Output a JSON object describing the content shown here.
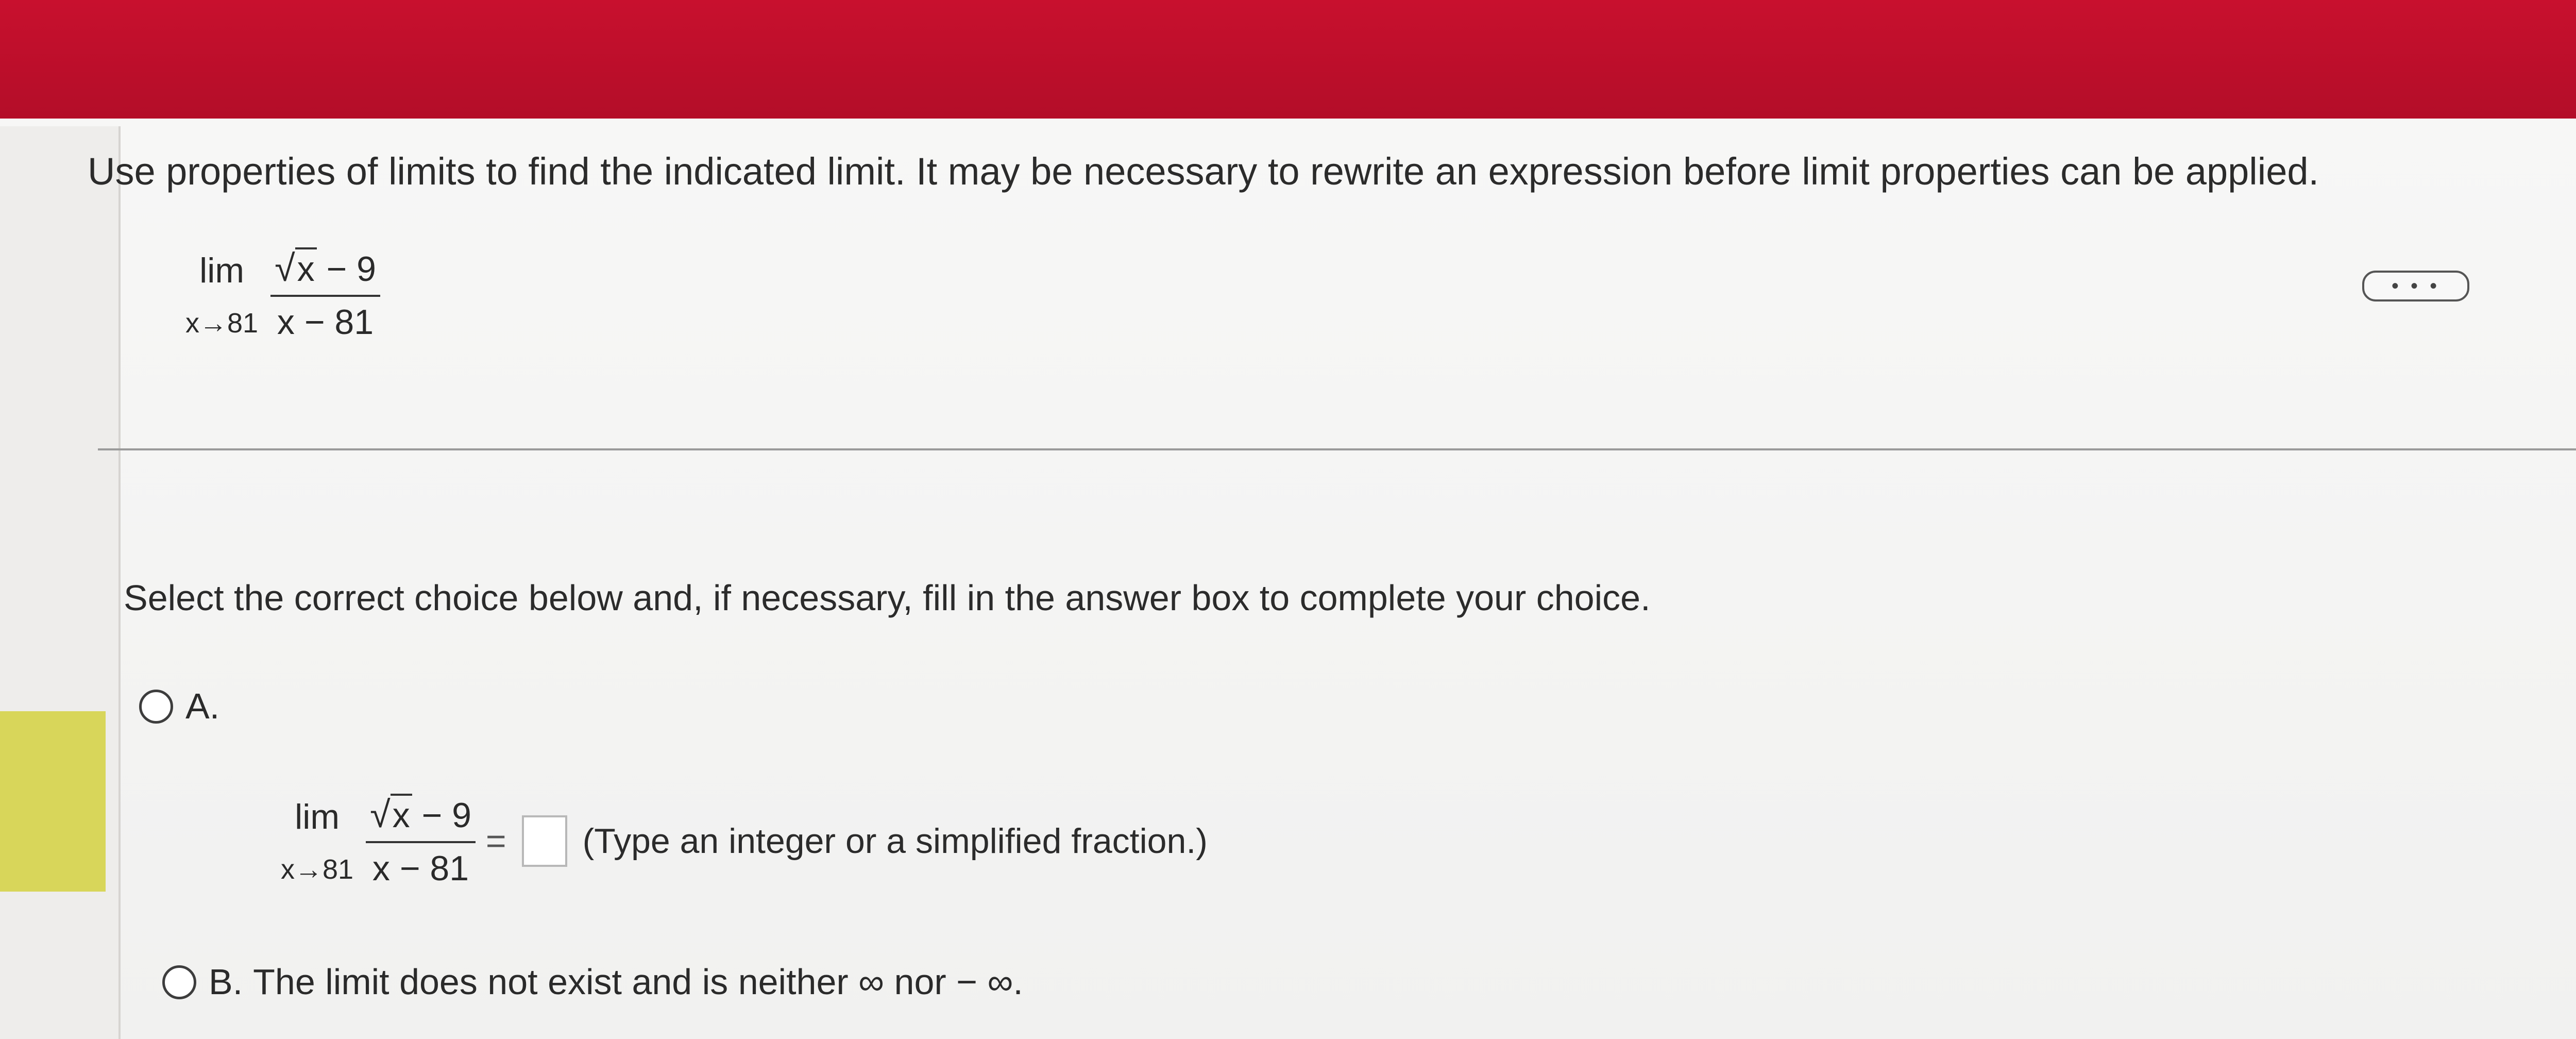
{
  "colors": {
    "header_red": "#c8102e",
    "highlight_yellow": "#d8d65a"
  },
  "question": {
    "instruction": "Use properties of limits to find the indicated limit. It may be necessary to rewrite an expression before limit properties can be applied.",
    "limit": {
      "lim": "lim",
      "approach": "x→81",
      "sqrt_symbol": "√",
      "radicand": "x",
      "numerator_rest": " − 9",
      "denominator": "x − 81"
    }
  },
  "more_button": {
    "label": "• • •"
  },
  "answer_section": {
    "prompt": "Select the correct choice below and, if necessary, fill in the answer box to complete your choice.",
    "choice_a": {
      "letter": "A.",
      "limit": {
        "lim": "lim",
        "approach": "x→81",
        "sqrt_symbol": "√",
        "radicand": "x",
        "numerator_rest": " − 9",
        "denominator": "x − 81"
      },
      "equals": "=",
      "answer_value": "",
      "hint": "(Type an integer or a simplified fraction.)"
    },
    "choice_b": {
      "letter": "B.",
      "text": "The limit does not exist and is neither ∞ nor − ∞."
    }
  }
}
